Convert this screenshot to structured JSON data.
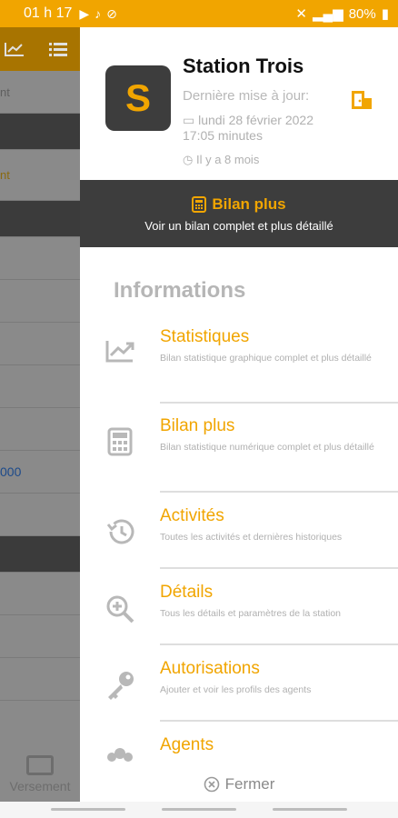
{
  "status_bar": {
    "time": "01 h 17",
    "battery": "80%"
  },
  "background": {
    "rows": [
      "nt",
      "",
      "nt",
      "",
      "",
      "",
      "",
      "",
      "000",
      "",
      "",
      "",
      "",
      "",
      ""
    ],
    "bottom_label": "Versement"
  },
  "drawer": {
    "logo_letter": "S",
    "station_name": "Station Trois",
    "update_label": "Dernière mise à jour:",
    "update_date": "lundi 28 février 2022",
    "update_time": "17:05 minutes",
    "update_ago": "Il y a 8 mois",
    "banner": {
      "title": "Bilan plus",
      "subtitle": "Voir un bilan complet et plus détaillé"
    },
    "section_title": "Informations",
    "menu": [
      {
        "title": "Statistiques",
        "desc": "Bilan statistique graphique complet et plus détaillé",
        "icon": "chart-icon"
      },
      {
        "title": "Bilan plus",
        "desc": "Bilan statistique numérique complet et plus détaillé",
        "icon": "calculator-icon"
      },
      {
        "title": "Activités",
        "desc": "Toutes les activités et dernières historiques",
        "icon": "history-icon"
      },
      {
        "title": "Détails",
        "desc": "Tous les détails et paramètres de la station",
        "icon": "zoom-in-icon"
      },
      {
        "title": "Autorisations",
        "desc": "Ajouter et voir les profils des agents",
        "icon": "key-icon"
      },
      {
        "title": "Agents",
        "desc": "",
        "icon": "agents-icon"
      }
    ],
    "close_label": "Fermer"
  },
  "colors": {
    "accent": "#F1A500",
    "dark": "#3d3d3d"
  }
}
